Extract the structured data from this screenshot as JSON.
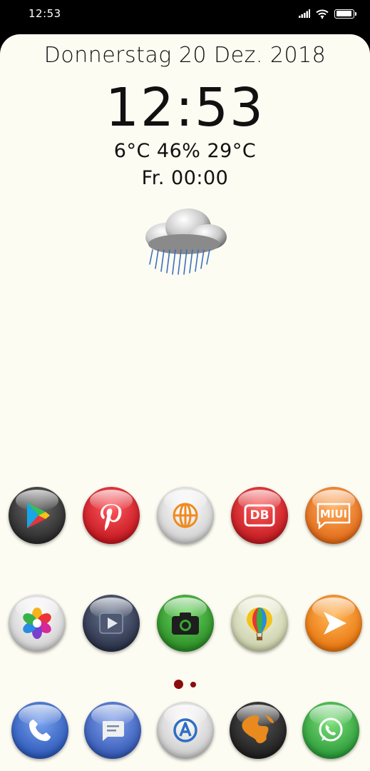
{
  "status": {
    "time": "12:53",
    "battery_level": 0.92
  },
  "widget": {
    "date": "Donnerstag 20 Dez. 2018",
    "time": "12:53",
    "weather": "6°C 46% 29°C",
    "next_alarm": "Fr. 00:00",
    "weather_icon": "rain-cloud-icon"
  },
  "rows": [
    [
      {
        "icon": "play-store-icon",
        "color": "#3a3a3a"
      },
      {
        "icon": "pinterest-icon",
        "color": "#d3242c"
      },
      {
        "icon": "browser-icon",
        "color": "#e9e9e9"
      },
      {
        "icon": "db-icon",
        "label": "DB",
        "color": "#d9242b"
      },
      {
        "icon": "miui-icon",
        "label": "MIUI",
        "color": "#ea7424"
      }
    ],
    [
      {
        "icon": "gallery-icon",
        "color": "#eeeeee"
      },
      {
        "icon": "video-player-icon",
        "color": "#3a4258"
      },
      {
        "icon": "camera-icon",
        "color": "#3aa633"
      },
      {
        "icon": "balloon-icon",
        "color": "#dfe3c8"
      },
      {
        "icon": "arrow-play-icon",
        "color": "#f28a1c"
      }
    ],
    [
      {
        "icon": "phone-icon",
        "color": "#3e6ed0"
      },
      {
        "icon": "messages-icon",
        "color": "#4772cf"
      },
      {
        "icon": "email-icon",
        "color": "#e8e8e8"
      },
      {
        "icon": "globe-icon",
        "color": "#383838"
      },
      {
        "icon": "whatsapp-icon",
        "color": "#3ab24a"
      }
    ]
  ],
  "pager": {
    "pages": 2,
    "current": 1
  }
}
